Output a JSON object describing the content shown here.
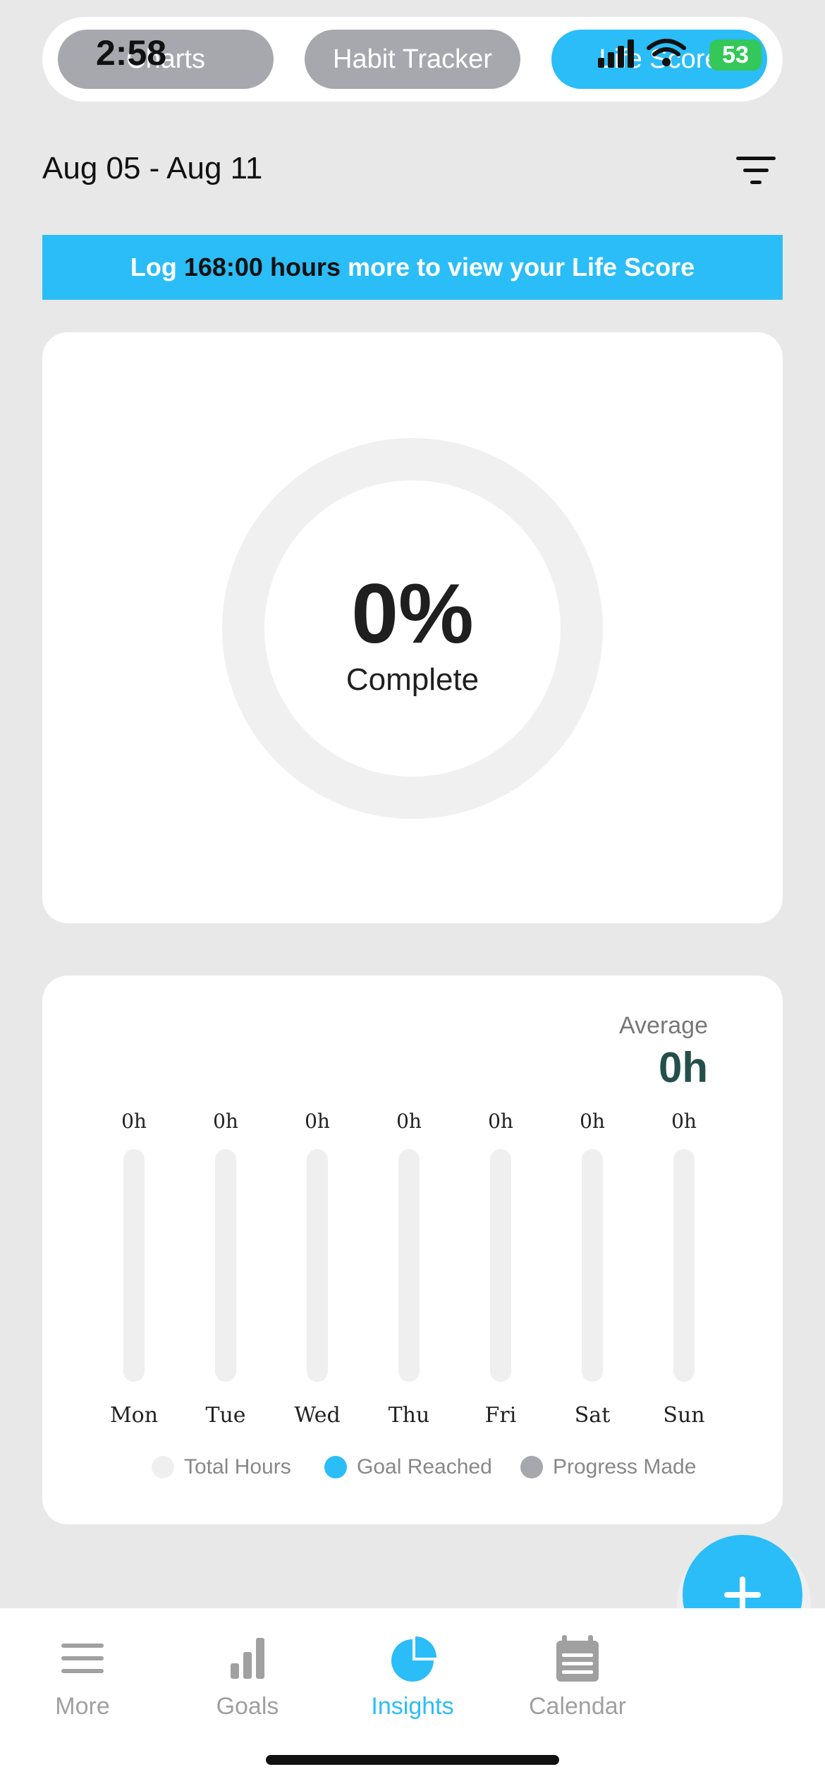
{
  "status_bar": {
    "time": "2:58",
    "battery": "53"
  },
  "top_tabs": [
    {
      "label": "Charts"
    },
    {
      "label": "Habit Tracker"
    },
    {
      "label": "Life Score"
    }
  ],
  "date_range": "Aug 05 - Aug 11",
  "banner": {
    "prefix": "Log",
    "highlight": "168:00 hours",
    "suffix": "more to view your Life Score"
  },
  "progress": {
    "percent": "0%",
    "label": "Complete"
  },
  "chart": {
    "average_label": "Average",
    "average_value": "0h"
  },
  "chart_data": {
    "type": "bar",
    "categories": [
      "Mon",
      "Tue",
      "Wed",
      "Thu",
      "Fri",
      "Sat",
      "Sun"
    ],
    "values": [
      0,
      0,
      0,
      0,
      0,
      0,
      0
    ],
    "value_labels": [
      "0h",
      "0h",
      "0h",
      "0h",
      "0h",
      "0h",
      "0h"
    ],
    "legend": [
      {
        "name": "Total Hours",
        "color": "#efefef"
      },
      {
        "name": "Goal Reached",
        "color": "#2bbdf7"
      },
      {
        "name": "Progress Made",
        "color": "#a6a8ad"
      }
    ]
  },
  "bottom_nav": [
    {
      "label": "More",
      "icon": "menu-icon"
    },
    {
      "label": "Goals",
      "icon": "bar-chart-icon"
    },
    {
      "label": "Insights",
      "icon": "pie-chart-icon",
      "active": true
    },
    {
      "label": "Calendar",
      "icon": "calendar-icon"
    }
  ],
  "colors": {
    "accent": "#2bbdf7",
    "inactive_tab": "#a6a8ad",
    "background": "#e8e8e8"
  }
}
